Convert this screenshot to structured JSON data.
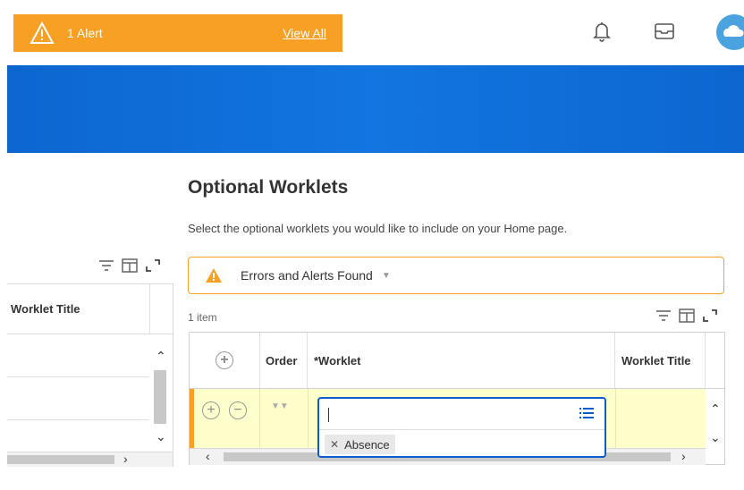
{
  "alert": {
    "text": "1 Alert",
    "link": "View All"
  },
  "icons": {
    "bell": "bell-icon",
    "inbox": "inbox-icon",
    "avatar": "cloud-avatar-icon"
  },
  "colors": {
    "alert_orange": "#f8a024",
    "brand_blue": "#0f6fd8",
    "row_highlight": "#ffffcc",
    "focus_blue": "#0a5ccf"
  },
  "left_table": {
    "header": "Worklet Title"
  },
  "main": {
    "title": "Optional Worklets",
    "subtitle": "Select the optional worklets you would like to include on your Home page.",
    "errors_label": "Errors and Alerts Found",
    "items_count": "1 item",
    "columns": [
      "Order",
      "*Worklet",
      "Worklet Title"
    ],
    "selected_chip": "Absence"
  }
}
